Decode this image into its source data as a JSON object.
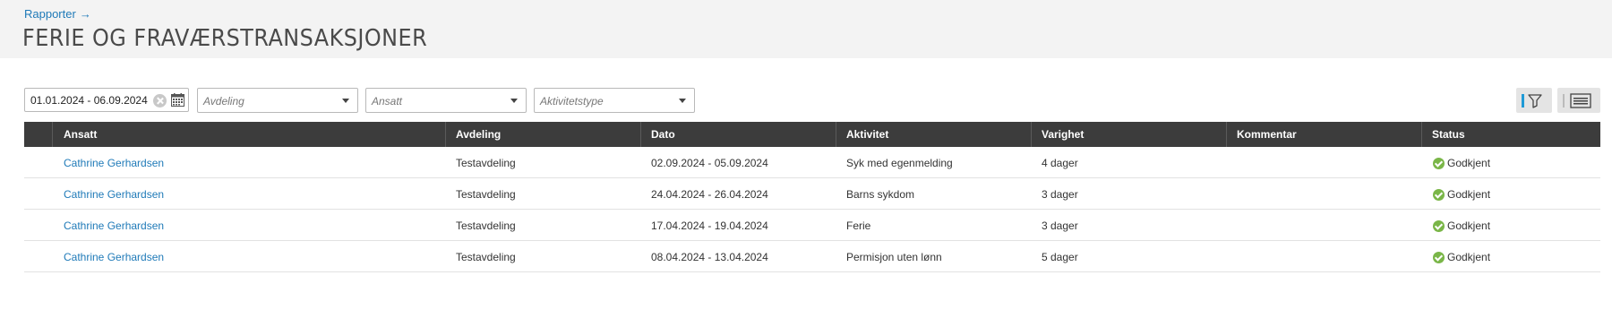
{
  "header": {
    "breadcrumb": "Rapporter",
    "breadcrumb_arrow": "→",
    "title": "FERIE OG FRAVÆRSTRANSAKSJONER"
  },
  "filters": {
    "date_range": "01.01.2024 - 06.09.2024",
    "department_placeholder": "Avdeling",
    "employee_placeholder": "Ansatt",
    "activity_type_placeholder": "Aktivitetstype"
  },
  "icons": {
    "clear": "clear-icon",
    "calendar": "calendar-icon",
    "dropdown": "chevron-down-icon",
    "filter": "filter-icon",
    "list_view": "list-view-icon",
    "status_ok": "check-circle-icon"
  },
  "colors": {
    "link": "#1f7ab8",
    "header_bg": "#f3f3f3",
    "table_header_bg": "#3c3c3c",
    "status_ok": "#7ab648",
    "filter_accent": "#1f9ad6"
  },
  "table": {
    "columns": [
      "Ansatt",
      "Avdeling",
      "Dato",
      "Aktivitet",
      "Varighet",
      "Kommentar",
      "Status"
    ],
    "rows": [
      {
        "employee": "Cathrine Gerhardsen",
        "department": "Testavdeling",
        "date": "02.09.2024 - 05.09.2024",
        "activity": "Syk med egenmelding",
        "duration": "4 dager",
        "comment": "",
        "status": "Godkjent"
      },
      {
        "employee": "Cathrine Gerhardsen",
        "department": "Testavdeling",
        "date": "24.04.2024 - 26.04.2024",
        "activity": "Barns sykdom",
        "duration": "3 dager",
        "comment": "",
        "status": "Godkjent"
      },
      {
        "employee": "Cathrine Gerhardsen",
        "department": "Testavdeling",
        "date": "17.04.2024 - 19.04.2024",
        "activity": "Ferie",
        "duration": "3 dager",
        "comment": "",
        "status": "Godkjent"
      },
      {
        "employee": "Cathrine Gerhardsen",
        "department": "Testavdeling",
        "date": "08.04.2024 - 13.04.2024",
        "activity": "Permisjon uten lønn",
        "duration": "5 dager",
        "comment": "",
        "status": "Godkjent"
      }
    ]
  }
}
